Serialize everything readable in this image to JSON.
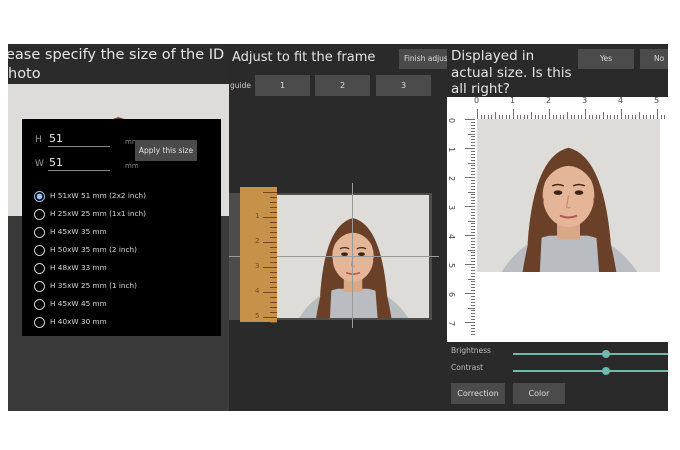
{
  "left_panel": {
    "title_line1": "ease specify the size of the ID",
    "title_line2": "hoto",
    "height_label": "H",
    "height_value": "51",
    "width_label": "W",
    "width_value": "51",
    "unit": "mm",
    "apply_button": "Apply this size",
    "size_options": [
      {
        "label": "H 51xW 51 mm (2x2 inch)",
        "selected": true
      },
      {
        "label": "H 25xW 25 mm (1x1 inch)",
        "selected": false
      },
      {
        "label": "H 45xW 35 mm",
        "selected": false
      },
      {
        "label": "H 50xW 35 mm (2 inch)",
        "selected": false
      },
      {
        "label": "H 48xW 33 mm",
        "selected": false
      },
      {
        "label": "H 35xW 25 mm (1 inch)",
        "selected": false
      },
      {
        "label": "H 45xW 45 mm",
        "selected": false
      },
      {
        "label": "H 40xW 30 mm",
        "selected": false
      }
    ]
  },
  "middle_panel": {
    "title": "Adjust to fit the frame",
    "finish_button": "Finish adjust",
    "guide_label": "guide",
    "guide_buttons": [
      "1",
      "2",
      "3"
    ],
    "ruler_numbers": [
      "1",
      "2",
      "3",
      "4",
      "5"
    ]
  },
  "right_panel": {
    "title": "Displayed in actual size. Is this all right?",
    "yes_button": "Yes",
    "no_button": "No",
    "horizontal_ruler_numbers": [
      "0",
      "1",
      "2",
      "3",
      "4",
      "5"
    ],
    "vertical_ruler_numbers": [
      "0",
      "1",
      "2",
      "3",
      "4",
      "5",
      "6",
      "7"
    ],
    "brightness_label": "Brightness",
    "brightness_level": 0.6,
    "contrast_label": "Contrast",
    "contrast_level": 0.6,
    "correction_button": "Correction",
    "color_button": "Color"
  },
  "colors": {
    "panel_bg": "#2a2a2a",
    "button_bg": "#4b4b4b",
    "slider": "#70b8b0",
    "ruler_wood": "#c8914a",
    "radio_selected": "#9cc3f0"
  }
}
